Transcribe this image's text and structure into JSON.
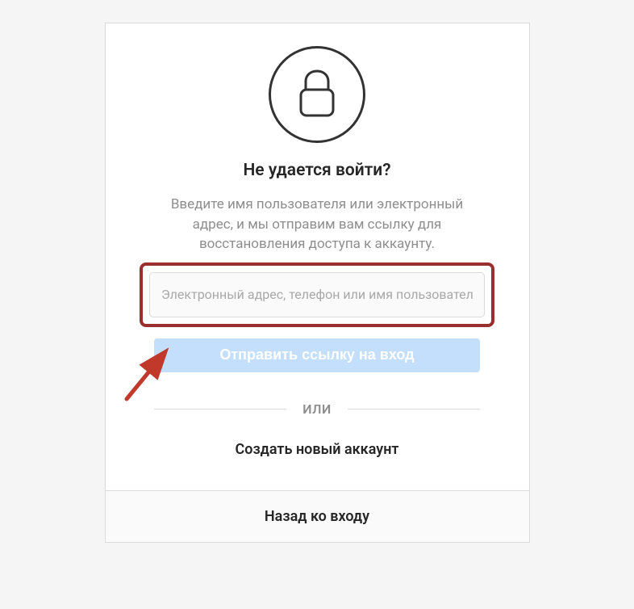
{
  "heading": "Не удается войти?",
  "description": "Введите имя пользователя или электронный адрес, и мы отправим вам ссылку для восстановления доступа к аккаунту.",
  "input": {
    "placeholder": "Электронный адрес, телефон или имя пользователя",
    "value": ""
  },
  "send_button_label": "Отправить ссылку на вход",
  "divider_label": "ИЛИ",
  "create_account_label": "Создать новый аккаунт",
  "back_to_login_label": "Назад ко входу",
  "colors": {
    "highlight_border": "#9a2f2f",
    "arrow": "#c0392b",
    "button_bg": "#c3dffb"
  }
}
